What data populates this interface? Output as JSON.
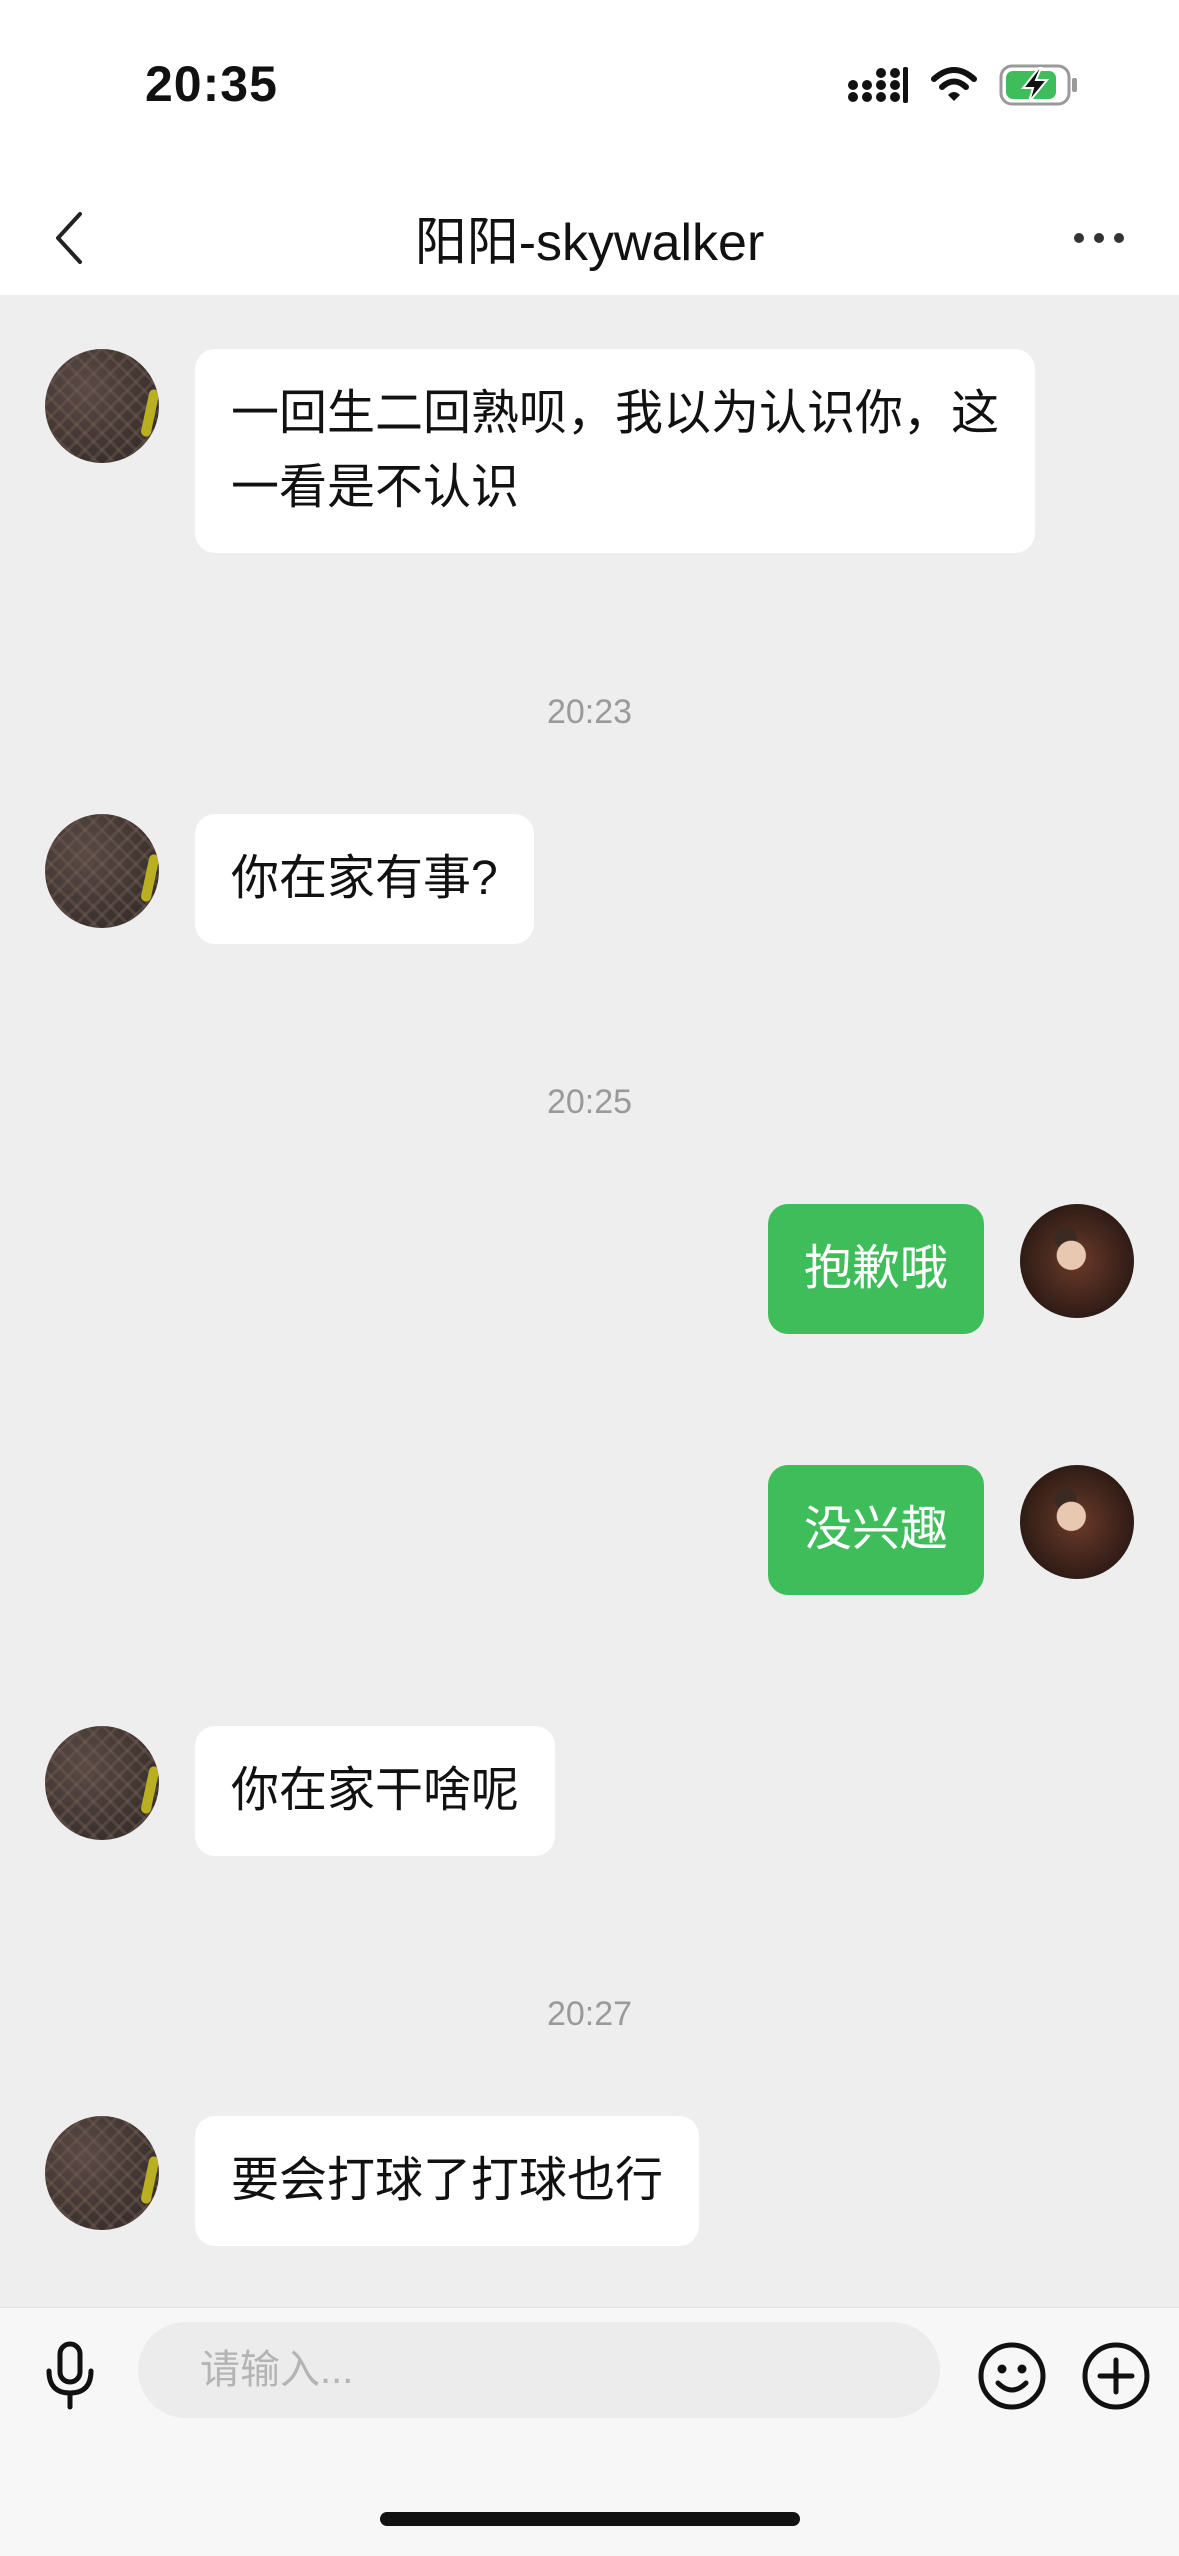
{
  "status_bar": {
    "time": "20:35",
    "icons": [
      "signal-icon",
      "wifi-icon",
      "battery-charging-icon"
    ],
    "battery_color": "#3fbd5a"
  },
  "nav": {
    "title": "阳阳-skywalker",
    "back_icon": "chevron-left-icon",
    "more_icon": "more-dots-icon"
  },
  "messages": [
    {
      "type": "message",
      "sender": "peer",
      "text": "一回生二回熟呗，我以为认识你，这一看是不认识"
    },
    {
      "type": "timestamp",
      "text": "20:23"
    },
    {
      "type": "message",
      "sender": "peer",
      "text": "你在家有事?"
    },
    {
      "type": "timestamp",
      "text": "20:25"
    },
    {
      "type": "message",
      "sender": "self",
      "text": "抱歉哦"
    },
    {
      "type": "message",
      "sender": "self",
      "text": "没兴趣"
    },
    {
      "type": "message",
      "sender": "peer",
      "text": "你在家干啥呢"
    },
    {
      "type": "timestamp",
      "text": "20:27"
    },
    {
      "type": "message",
      "sender": "peer",
      "text": "要会打球了打球也行"
    }
  ],
  "input_bar": {
    "placeholder": "请输入...",
    "value": "",
    "left_icon": "microphone-icon",
    "right_icons": [
      "emoji-icon",
      "plus-circle-icon"
    ]
  },
  "colors": {
    "chat_background": "#eeeeee",
    "self_bubble": "#3fbd5a",
    "peer_bubble": "#ffffff",
    "timestamp_text": "#9a9a9a"
  }
}
